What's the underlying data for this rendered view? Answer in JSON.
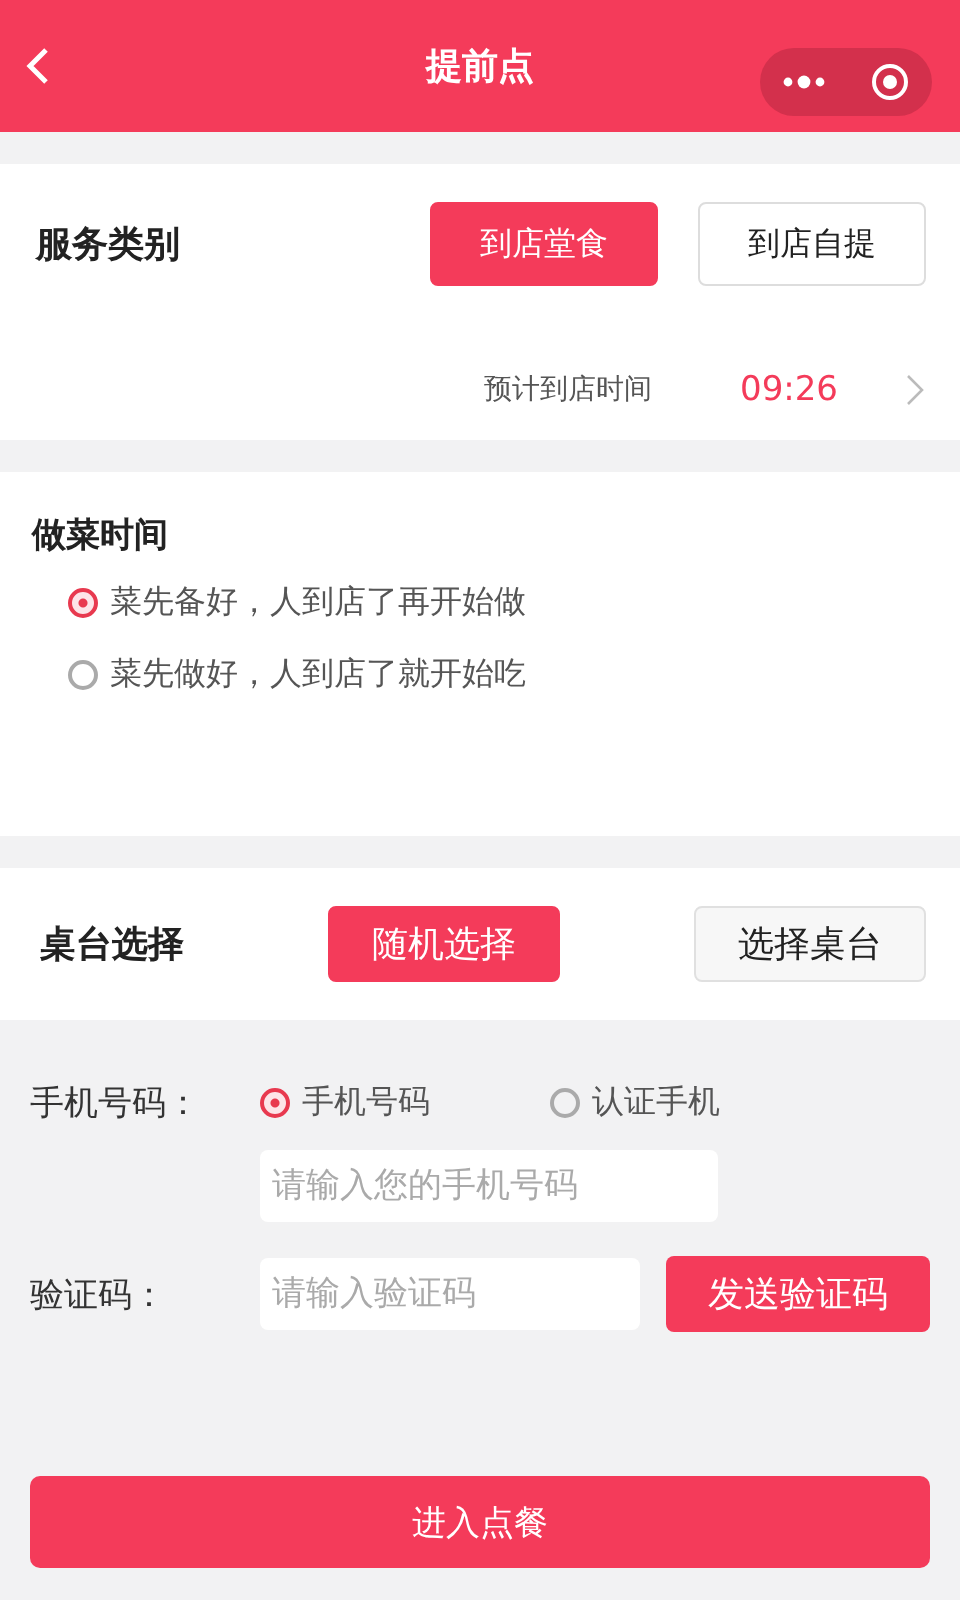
{
  "nav": {
    "title": "提前点"
  },
  "service": {
    "label": "服务类别",
    "options": [
      {
        "label": "到店堂食",
        "selected": true
      },
      {
        "label": "到店自提",
        "selected": false
      }
    ],
    "time_label": "预计到店时间",
    "time": "09:26"
  },
  "cooking": {
    "label": "做菜时间",
    "options": [
      {
        "label": "菜先备好，人到店了再开始做",
        "selected": true
      },
      {
        "label": "菜先做好，人到店了就开始吃",
        "selected": false
      }
    ]
  },
  "table": {
    "label": "桌台选择",
    "options": [
      {
        "label": "随机选择",
        "selected": true
      },
      {
        "label": "选择桌台",
        "selected": false
      }
    ]
  },
  "phone": {
    "label": "手机号码：",
    "options": [
      {
        "label": "手机号码",
        "selected": true
      },
      {
        "label": "认证手机",
        "selected": false
      }
    ],
    "placeholder": "请输入您的手机号码"
  },
  "code": {
    "label": "验证码：",
    "placeholder": "请输入验证码",
    "send_button": "发送验证码"
  },
  "submit": "进入点餐"
}
